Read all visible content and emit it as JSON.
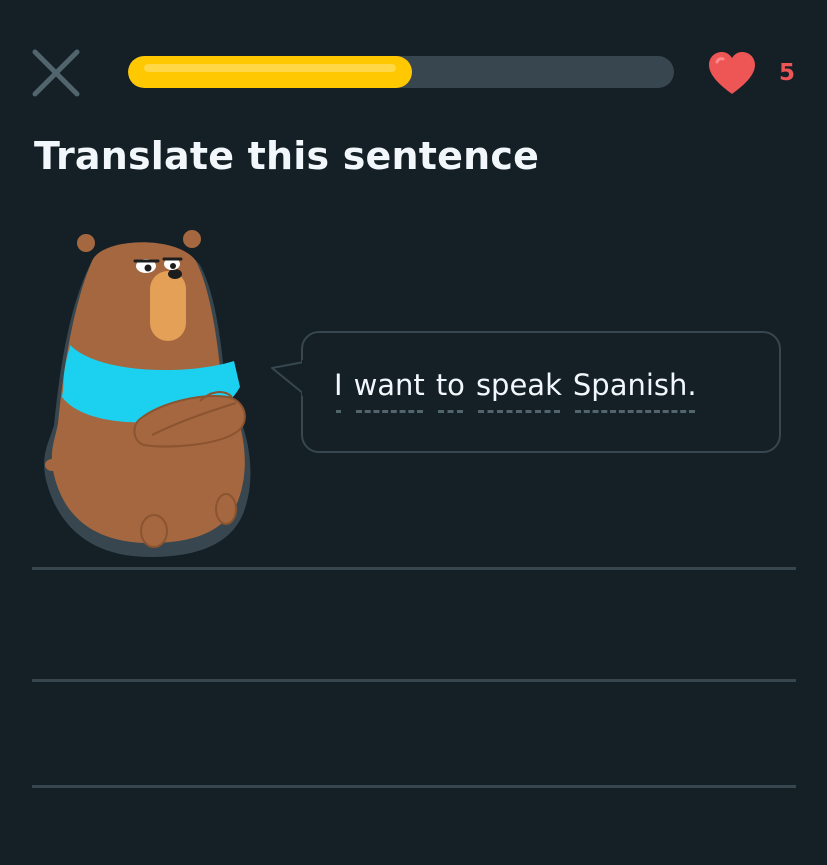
{
  "header": {
    "close_icon": "close-x-icon",
    "progress": 0.52,
    "hearts_icon": "heart-icon",
    "hearts_count": "5",
    "colors": {
      "background": "#141f26",
      "progress_fill": "#ffc800",
      "progress_track": "#37464f",
      "heart": "#ee5555"
    }
  },
  "exercise": {
    "title": "Translate this sentence",
    "character": "bear-character",
    "prompt_words": [
      "I",
      "want",
      "to",
      "speak",
      "Spanish."
    ]
  },
  "answer_area": {
    "line_count": 3
  }
}
